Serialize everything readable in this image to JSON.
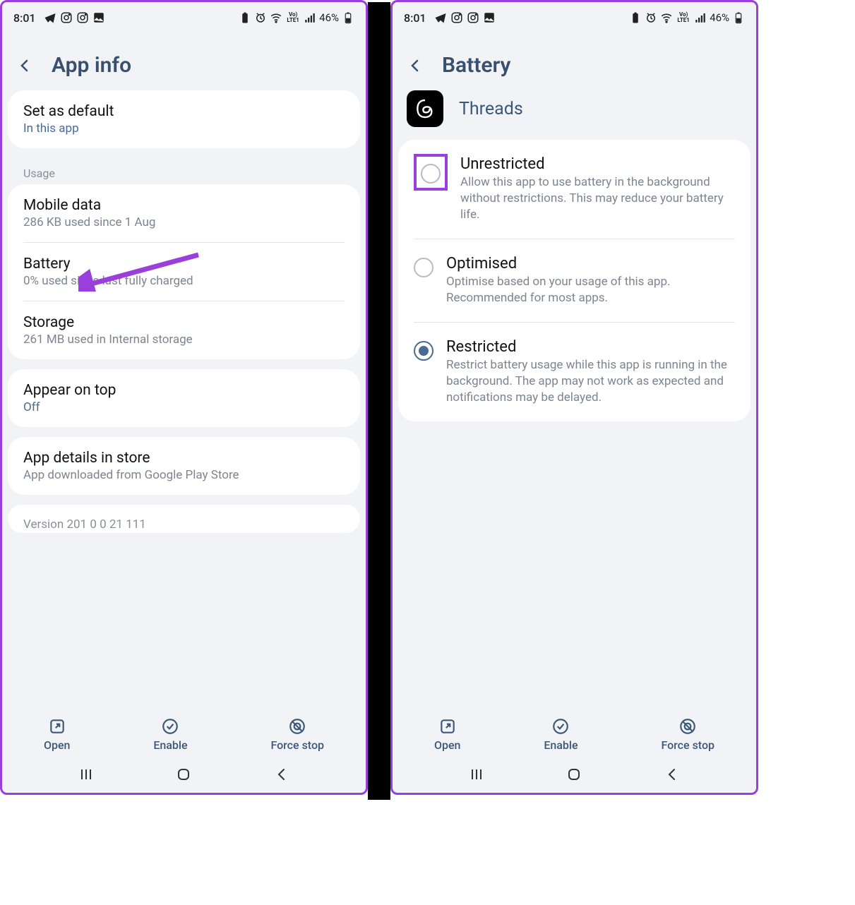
{
  "statusbar": {
    "time": "8:01",
    "battery_pct": "46%"
  },
  "left": {
    "title": "App info",
    "set_default": {
      "title": "Set as default",
      "sub": "In this app"
    },
    "usage_label": "Usage",
    "mobile_data": {
      "title": "Mobile data",
      "sub": "286 KB used since 1 Aug"
    },
    "battery": {
      "title": "Battery",
      "sub": "0% used since last fully charged"
    },
    "storage": {
      "title": "Storage",
      "sub": "261 MB used in Internal storage"
    },
    "appear": {
      "title": "Appear on top",
      "sub": "Off"
    },
    "details": {
      "title": "App details in store",
      "sub": "App downloaded from Google Play Store"
    },
    "version_peek": "Version 201 0 0 21 111"
  },
  "right": {
    "title": "Battery",
    "app_name": "Threads",
    "options": {
      "unrestricted": {
        "title": "Unrestricted",
        "desc": "Allow this app to use battery in the background without restrictions. This may reduce your battery life."
      },
      "optimised": {
        "title": "Optimised",
        "desc": "Optimise based on your usage of this app. Recommended for most apps."
      },
      "restricted": {
        "title": "Restricted",
        "desc": "Restrict battery usage while this app is running in the background. The app may not work as expected and notifications may be delayed."
      }
    }
  },
  "actions": {
    "open": "Open",
    "enable": "Enable",
    "force_stop": "Force stop"
  }
}
